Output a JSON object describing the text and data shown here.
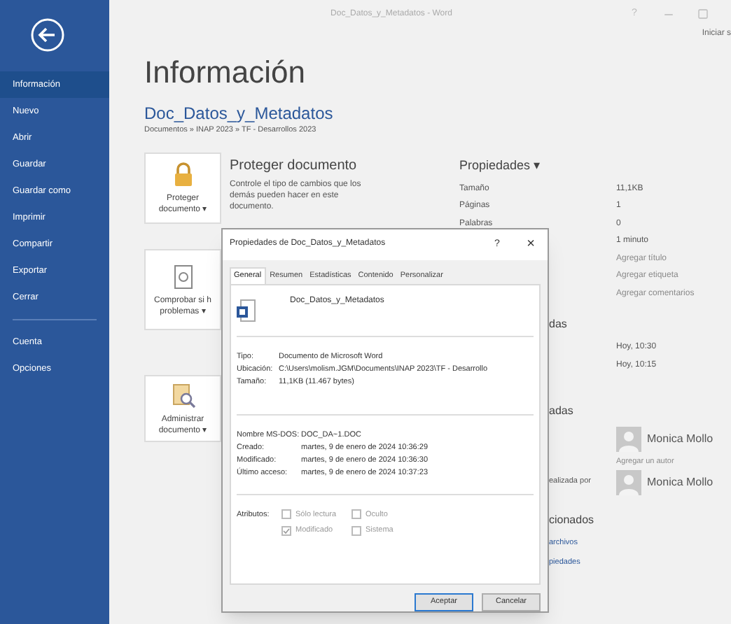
{
  "window": {
    "title": "Doc_Datos_y_Metadatos - Word",
    "help": "?",
    "account": "Iniciar s"
  },
  "sidebar": {
    "items": [
      {
        "label": "Información",
        "selected": true
      },
      {
        "label": "Nuevo",
        "selected": false
      },
      {
        "label": "Abrir",
        "selected": false
      },
      {
        "label": "Guardar",
        "selected": false
      },
      {
        "label": "Guardar como",
        "selected": false
      },
      {
        "label": "Imprimir",
        "selected": false
      },
      {
        "label": "Compartir",
        "selected": false
      },
      {
        "label": "Exportar",
        "selected": false
      },
      {
        "label": "Cerrar",
        "selected": false
      }
    ],
    "footer_items": [
      {
        "label": "Cuenta",
        "selected": false
      },
      {
        "label": "Opciones",
        "selected": false
      }
    ]
  },
  "page": {
    "title": "Información",
    "document": "Doc_Datos_y_Metadatos",
    "path": "Documentos » INAP 2023 » TF - Desarrollos 2023"
  },
  "protect": {
    "button": [
      "Proteger",
      "documento ▾"
    ],
    "title": "Proteger documento",
    "description": "Controle el tipo de cambios que los demás pueden hacer en este documento."
  },
  "inspect": {
    "button": [
      "Comprobar si h",
      "problemas ▾"
    ]
  },
  "manage": {
    "button": [
      "Administrar",
      "documento ▾"
    ]
  },
  "properties": {
    "header": "Propiedades ▾",
    "rows": [
      {
        "label": "Tamaño",
        "value": "11,1KB",
        "kind": "text"
      },
      {
        "label": "Páginas",
        "value": "1",
        "kind": "text"
      },
      {
        "label": "Palabras",
        "value": "0",
        "kind": "text"
      },
      {
        "value": "1 minuto",
        "kind": "text"
      },
      {
        "value": "Agregar título",
        "kind": "link"
      },
      {
        "value": "Agregar etiqueta",
        "kind": "link"
      },
      {
        "value": "Agregar comentarios",
        "kind": "link"
      }
    ]
  },
  "dates": {
    "header": "das",
    "rows": [
      "Hoy, 10:30",
      "Hoy, 10:15"
    ]
  },
  "people": {
    "header": "adas",
    "author": "Monica Mollo",
    "add_author": "Agregar un autor",
    "modified_label": "ealizada por",
    "modified_by": "Monica Mollo"
  },
  "related": {
    "header": "cionados",
    "links": [
      "archivos",
      "piedades"
    ]
  },
  "dialog": {
    "title": "Propiedades de Doc_Datos_y_Metadatos",
    "help": "?",
    "close": "×",
    "tabs": [
      {
        "label": "General",
        "selected": true
      },
      {
        "label": "Resumen",
        "selected": false
      },
      {
        "label": "Estadísticas",
        "selected": false
      },
      {
        "label": "Contenido",
        "selected": false
      },
      {
        "label": "Personalizar",
        "selected": false
      }
    ],
    "file_name": "Doc_Datos_y_Metadatos",
    "info": [
      {
        "label": "Tipo:",
        "value": "Documento de Microsoft Word"
      },
      {
        "label": "Ubicación:",
        "value": "C:\\Users\\molism.JGM\\Documents\\INAP 2023\\TF - Desarrollo"
      },
      {
        "label": "Tamaño:",
        "value": "11,1KB (11.467 bytes)"
      }
    ],
    "dates": [
      {
        "label": "Nombre MS-DOS:",
        "value": "DOC_DA~1.DOC"
      },
      {
        "label": "Creado:",
        "value": "martes, 9 de enero de 2024 10:36:29"
      },
      {
        "label": "Modificado:",
        "value": "martes, 9 de enero de 2024 10:36:30"
      },
      {
        "label": "Último acceso:",
        "value": "martes, 9 de enero de 2024 10:37:23"
      }
    ],
    "attributes_label": "Atributos:",
    "attributes": [
      {
        "label": "Sólo lectura",
        "checked": false
      },
      {
        "label": "Oculto",
        "checked": false
      },
      {
        "label": "Modificado",
        "checked": true
      },
      {
        "label": "Sistema",
        "checked": false
      }
    ],
    "buttons": [
      {
        "label": "Aceptar",
        "default": true
      },
      {
        "label": "Cancelar",
        "default": false
      }
    ]
  }
}
